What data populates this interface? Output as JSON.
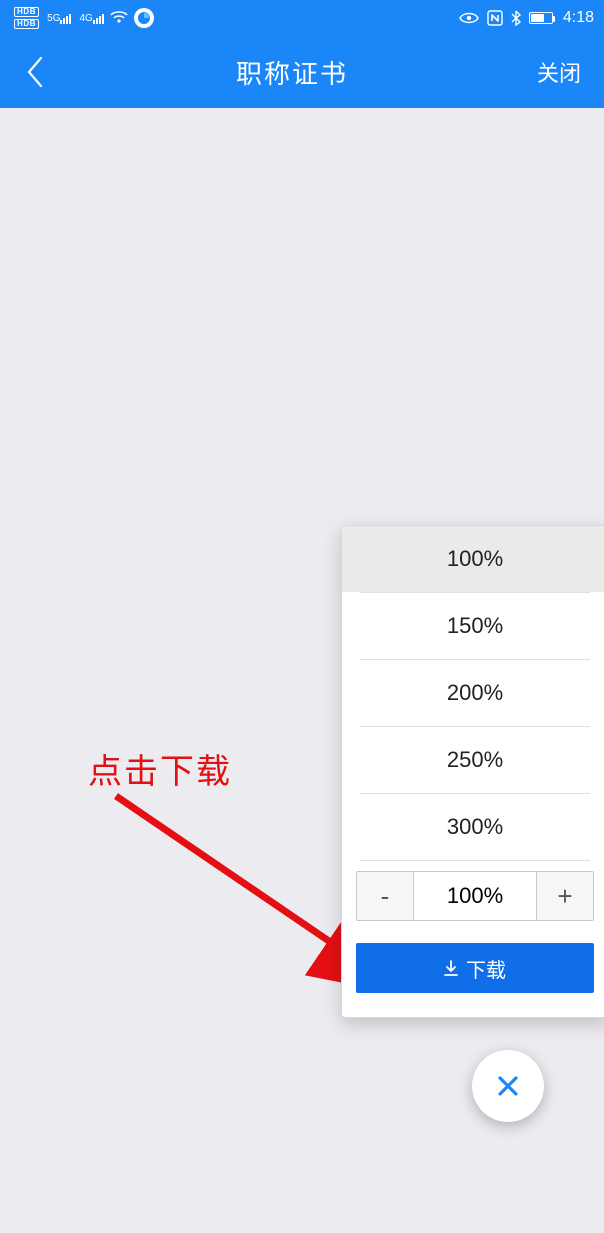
{
  "statusBar": {
    "hd": "HDB",
    "net5g": "5G",
    "net4g": "4G",
    "time": "4:18"
  },
  "header": {
    "title": "职称证书",
    "close": "关闭"
  },
  "annotation": {
    "label": "点击下载"
  },
  "zoomPanel": {
    "options": {
      "o1": "100%",
      "o2": "150%",
      "o3": "200%",
      "o4": "250%",
      "o5": "300%"
    },
    "stepper": {
      "minus": "-",
      "value": "100%",
      "plus": "+"
    },
    "download": "下载"
  }
}
